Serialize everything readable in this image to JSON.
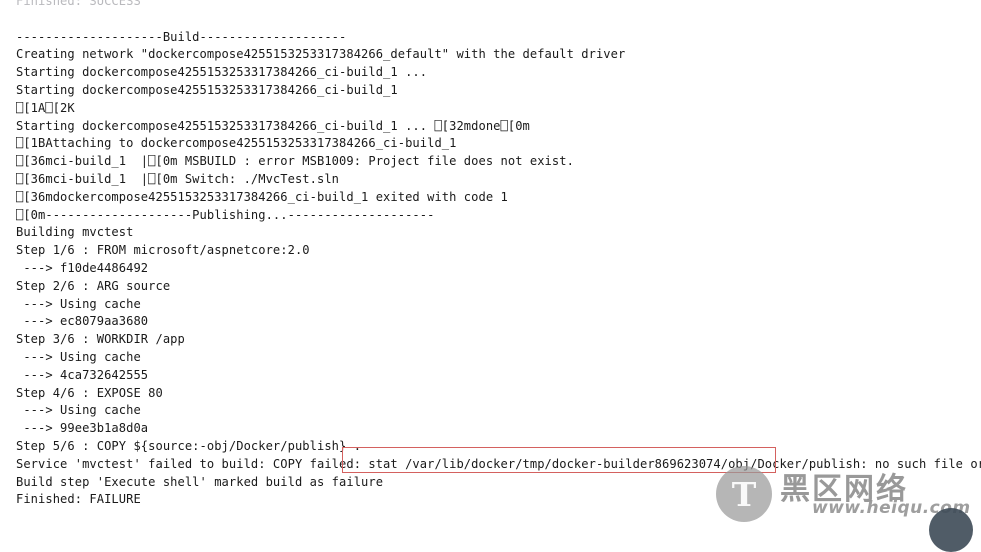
{
  "console": {
    "lines": [
      {
        "text": "Finished: SUCCESS",
        "clipped": true
      },
      {
        "text": ""
      },
      {
        "text": "--------------------Build--------------------"
      },
      {
        "text": "Creating network \"dockercompose4255153253317384266_default\" with the default driver"
      },
      {
        "text": "Starting dockercompose4255153253317384266_ci-build_1 ..."
      },
      {
        "text": "Starting dockercompose4255153253317384266_ci-build_1"
      },
      {
        "text": "⎕[1A⎕[2K"
      },
      {
        "text": "Starting dockercompose4255153253317384266_ci-build_1 ... ⎕[32mdone⎕[0m"
      },
      {
        "text": "⎕[1BAttaching to dockercompose4255153253317384266_ci-build_1"
      },
      {
        "text": "⎕[36mci-build_1  |⎕[0m MSBUILD : error MSB1009: Project file does not exist."
      },
      {
        "text": "⎕[36mci-build_1  |⎕[0m Switch: ./MvcTest.sln"
      },
      {
        "text": "⎕[36mdockercompose4255153253317384266_ci-build_1 exited with code 1"
      },
      {
        "text": "⎕[0m--------------------Publishing...--------------------"
      },
      {
        "text": "Building mvctest"
      },
      {
        "text": "Step 1/6 : FROM microsoft/aspnetcore:2.0"
      },
      {
        "text": " ---> f10de4486492"
      },
      {
        "text": "Step 2/6 : ARG source"
      },
      {
        "text": " ---> Using cache"
      },
      {
        "text": " ---> ec8079aa3680"
      },
      {
        "text": "Step 3/6 : WORKDIR /app"
      },
      {
        "text": " ---> Using cache"
      },
      {
        "text": " ---> 4ca732642555"
      },
      {
        "text": "Step 4/6 : EXPOSE 80"
      },
      {
        "text": " ---> Using cache"
      },
      {
        "text": " ---> 99ee3b1a8d0a"
      },
      {
        "text": "Step 5/6 : COPY ${source:-obj/Docker/publish} ."
      },
      {
        "text": "Service 'mvctest' failed to build: COPY failed: stat /var/lib/docker/tmp/docker-builder869623074/obj/Docker/publish: no such file or directory"
      },
      {
        "text": "Build step 'Execute shell' marked build as failure"
      },
      {
        "text": "Finished: FAILURE"
      }
    ]
  },
  "annotation": {
    "highlight_label": "error-path-highlight",
    "color": "#d4615f"
  },
  "watermark": {
    "logo_glyph": "T",
    "cn_text": "黑区网络",
    "url_text": "www.heiqu.com",
    "logo_color": "#9a9a9a",
    "text_color": "#8f8f8f"
  },
  "theme": {
    "background": "#ffffff",
    "text_color": "#1a1a1a"
  }
}
